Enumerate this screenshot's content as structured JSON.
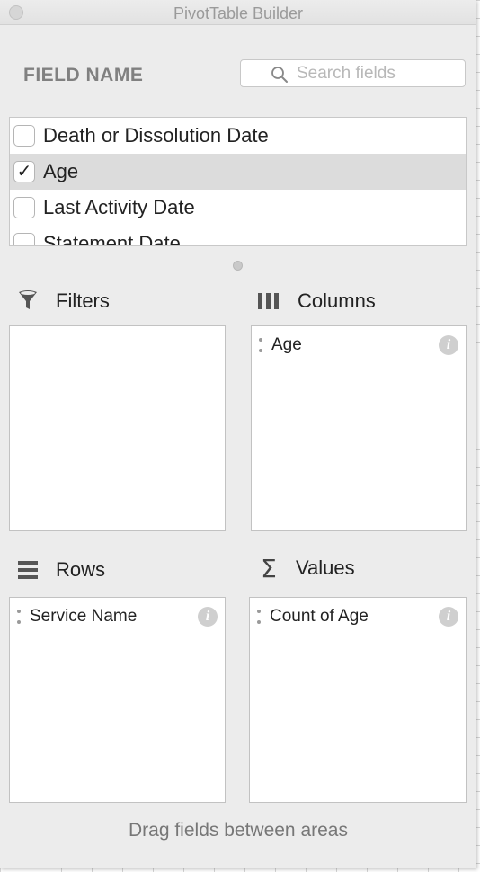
{
  "window": {
    "title": "PivotTable Builder"
  },
  "fields": {
    "header": "FIELD NAME",
    "search": {
      "placeholder": "Search fields",
      "value": ""
    },
    "items": [
      {
        "label": "Death or Dissolution Date",
        "checked": false,
        "selected": false
      },
      {
        "label": "Age",
        "checked": true,
        "selected": true
      },
      {
        "label": "Last Activity Date",
        "checked": false,
        "selected": false
      },
      {
        "label": "Statement Date",
        "checked": false,
        "selected": false
      }
    ],
    "check_glyph": "✓"
  },
  "areas": {
    "filters": {
      "label": "Filters",
      "icon": "funnel-icon",
      "items": []
    },
    "columns": {
      "label": "Columns",
      "icon": "columns-icon",
      "items": [
        {
          "label": "Age"
        }
      ]
    },
    "rows": {
      "label": "Rows",
      "icon": "rows-icon",
      "items": [
        {
          "label": "Service Name"
        }
      ]
    },
    "values": {
      "label": "Values",
      "icon": "sigma-icon",
      "glyph": "Σ",
      "items": [
        {
          "label": "Count of Age"
        }
      ]
    }
  },
  "info_glyph": "i",
  "footer": {
    "hint": "Drag fields between areas"
  }
}
